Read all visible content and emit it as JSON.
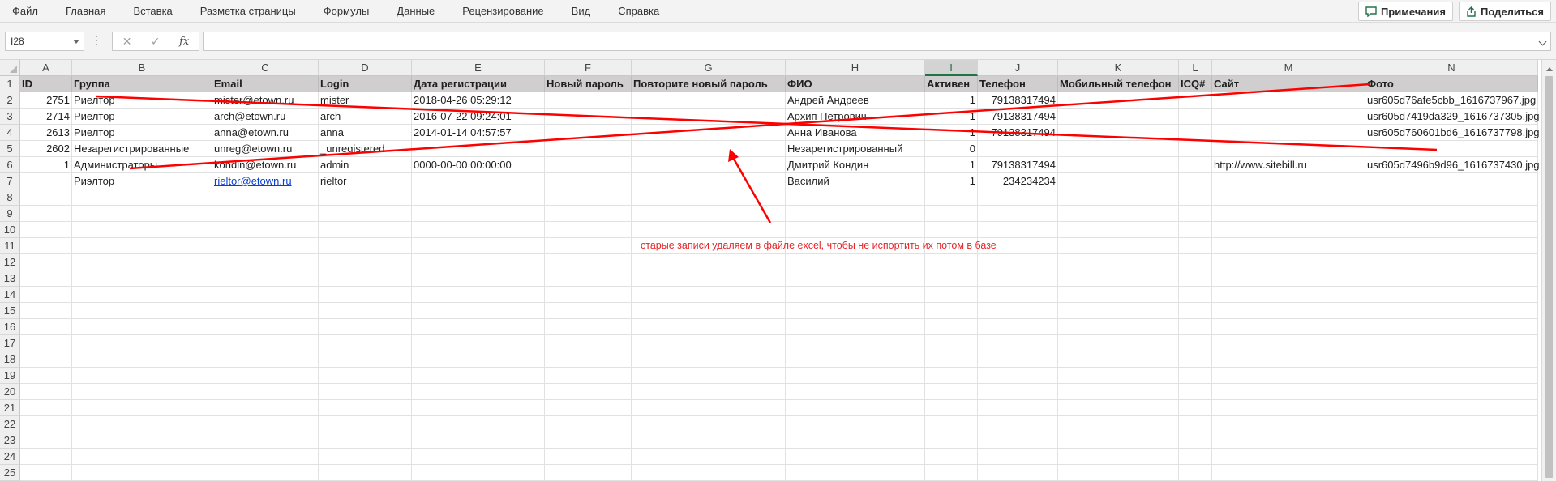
{
  "menu": [
    "Файл",
    "Главная",
    "Вставка",
    "Разметка страницы",
    "Формулы",
    "Данные",
    "Рецензирование",
    "Вид",
    "Справка"
  ],
  "actions": {
    "comments": "Примечания",
    "share": "Поделиться"
  },
  "formula_bar": {
    "name_box": "I28",
    "cancel": "✕",
    "enter": "✓",
    "fx": "fx",
    "formula": ""
  },
  "columns": [
    "A",
    "B",
    "C",
    "D",
    "E",
    "F",
    "G",
    "H",
    "I",
    "J",
    "K",
    "L",
    "M",
    "N"
  ],
  "selected_column": "I",
  "rows": [
    [
      "ID",
      "Группа",
      "Email",
      "Login",
      "Дата регистрации",
      "Новый пароль",
      "Повторите новый пароль",
      "ФИО",
      "Активен",
      "Телефон",
      "Мобильный телефон",
      "ICQ#",
      "Сайт",
      "Фото"
    ],
    [
      "2751",
      "Риелтор",
      "mister@etown.ru",
      "mister",
      "2018-04-26 05:29:12",
      "",
      "",
      "Андрей Андреев",
      "1",
      "79138317494",
      "",
      "",
      "",
      "usr605d76afe5cbb_1616737967.jpg"
    ],
    [
      "2714",
      "Риелтор",
      "arch@etown.ru",
      "arch",
      "2016-07-22 09:24:01",
      "",
      "",
      "Архип Петрович",
      "1",
      "79138317494",
      "",
      "",
      "",
      "usr605d7419da329_1616737305.jpg"
    ],
    [
      "2613",
      "Риелтор",
      "anna@etown.ru",
      "anna",
      "2014-01-14 04:57:57",
      "",
      "",
      "Анна Иванова",
      "1",
      "79138317494",
      "",
      "",
      "",
      "usr605d760601bd6_1616737798.jpg"
    ],
    [
      "2602",
      "Незарегистрированные",
      "unreg@etown.ru",
      "_unregistered",
      "",
      "",
      "",
      "Незарегистрированный",
      "0",
      "",
      "",
      "",
      "",
      ""
    ],
    [
      "1",
      "Администраторы",
      "kondin@etown.ru",
      "admin",
      "0000-00-00 00:00:00",
      "",
      "",
      "Дмитрий Кондин",
      "1",
      "79138317494",
      "",
      "",
      "http://www.sitebill.ru",
      "usr605d7496b9d96_1616737430.jpg"
    ],
    [
      "",
      "Риэлтор",
      "rieltor@etown.ru",
      "rieltor",
      "",
      "",
      "",
      "Василий",
      "1",
      "234234234",
      "",
      "",
      "",
      ""
    ]
  ],
  "row_numbers": [
    "1",
    "2",
    "3",
    "4",
    "5",
    "6",
    "7",
    "8",
    "9",
    "10",
    "11",
    "12",
    "13",
    "14",
    "15",
    "16",
    "17",
    "18",
    "19",
    "20",
    "21",
    "22",
    "23",
    "24",
    "25"
  ],
  "annotation": {
    "text": "старые записи удаляем в файле excel, чтобы не испортить их потом в базе",
    "color": "#e8262a"
  }
}
